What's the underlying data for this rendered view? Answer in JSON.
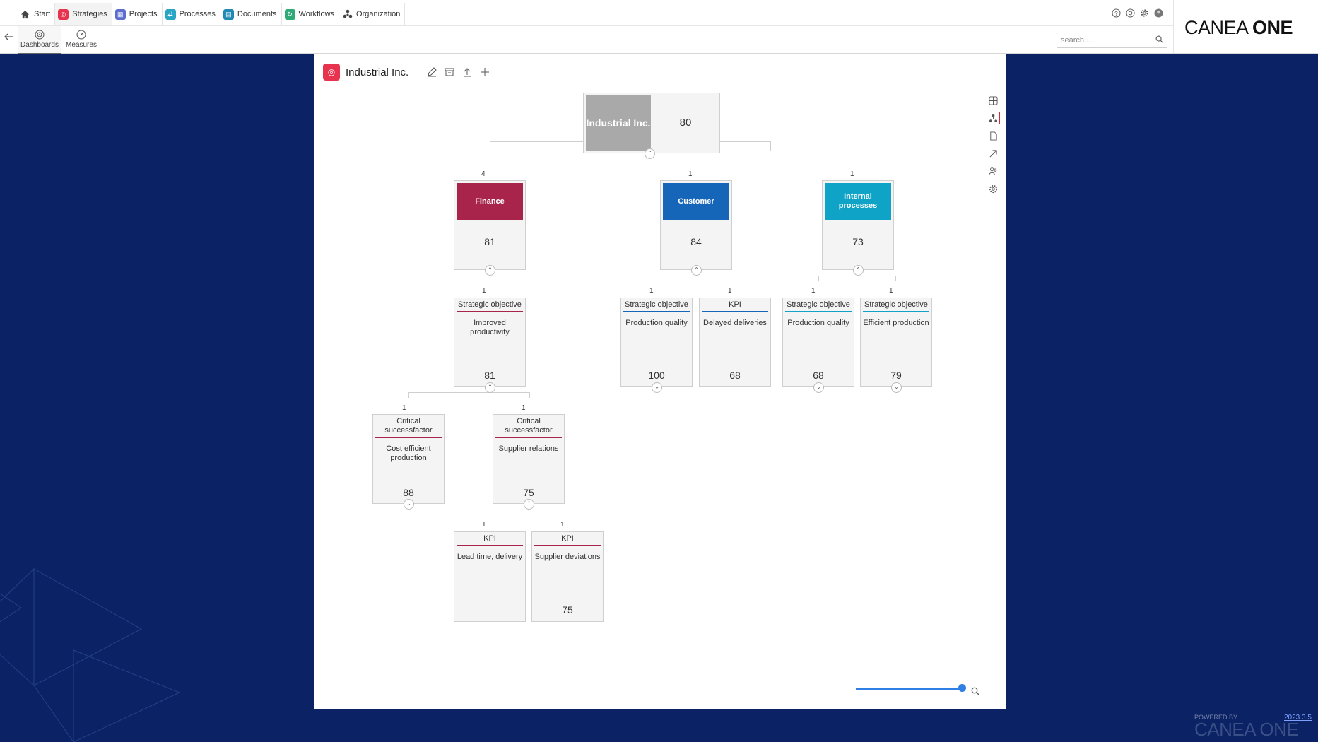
{
  "nav": {
    "tabs": [
      {
        "label": "Start",
        "icon": "home-icon",
        "color": "#444444"
      },
      {
        "label": "Strategies",
        "icon": "strategies-icon",
        "color": "#e8334f"
      },
      {
        "label": "Projects",
        "icon": "projects-icon",
        "color": "#5c6ccf"
      },
      {
        "label": "Processes",
        "icon": "processes-icon",
        "color": "#29a6c4"
      },
      {
        "label": "Documents",
        "icon": "documents-icon",
        "color": "#1f8ab3"
      },
      {
        "label": "Workflows",
        "icon": "workflows-icon",
        "color": "#2eaa77"
      },
      {
        "label": "Organization",
        "icon": "organization-icon",
        "color": "#444444"
      }
    ],
    "subtabs": [
      {
        "label": "Dashboards",
        "icon": "dashboard-icon"
      },
      {
        "label": "Measures",
        "icon": "gauge-icon"
      }
    ],
    "search_placeholder": "search...",
    "brand_light": "CANEA ",
    "brand_bold": "ONE"
  },
  "panel": {
    "title": "Industrial Inc.",
    "root": {
      "name": "Industrial Inc.",
      "value": "80",
      "color": "#a9a9a9"
    },
    "perspectives": [
      {
        "count": "4",
        "name": "Finance",
        "value": "81",
        "color": "#a8244b"
      },
      {
        "count": "1",
        "name": "Customer",
        "value": "84",
        "color": "#1565b8"
      },
      {
        "count": "1",
        "name": "Internal processes",
        "value": "73",
        "color": "#0ea3c7"
      }
    ],
    "finance_children": [
      {
        "count": "1",
        "type": "Strategic objective",
        "name": "Improved productivity",
        "value": "81"
      }
    ],
    "customer_children": [
      {
        "count": "1",
        "type": "Strategic objective",
        "name": "Production quality",
        "value": "100"
      },
      {
        "count": "1",
        "type": "KPI",
        "name": "Delayed deliveries",
        "value": "68"
      }
    ],
    "internal_children": [
      {
        "count": "1",
        "type": "Strategic objective",
        "name": "Production quality",
        "value": "68"
      },
      {
        "count": "1",
        "type": "Strategic objective",
        "name": "Efficient production",
        "value": "79"
      }
    ],
    "csf": [
      {
        "count": "1",
        "type": "Critical successfactor",
        "name": "Cost efficient production",
        "value": "88"
      },
      {
        "count": "1",
        "type": "Critical successfactor",
        "name": "Supplier relations",
        "value": "75"
      }
    ],
    "kpis": [
      {
        "count": "1",
        "type": "KPI",
        "name": "Lead time, delivery",
        "value": ""
      },
      {
        "count": "1",
        "type": "KPI",
        "name": "Supplier deviations",
        "value": "75"
      }
    ],
    "zoom_level": 1.0
  },
  "footer": {
    "powered": "POWERED BY",
    "brand": "CANEA ONE",
    "version": "2023.3.5"
  }
}
